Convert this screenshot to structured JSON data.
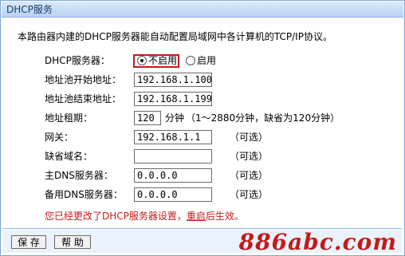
{
  "window": {
    "title": "DHCP服务"
  },
  "intro": "本路由器内建的DHCP服务器能自动配置局域网中各计算机的TCP/IP协议。",
  "fields": {
    "dhcp_server": {
      "label": "DHCP服务器：",
      "options": [
        "不启用",
        "启用"
      ],
      "selected": "不启用"
    },
    "pool_start": {
      "label": "地址池开始地址：",
      "value": "192.168.1.100"
    },
    "pool_end": {
      "label": "地址池结束地址：",
      "value": "192.168.1.199"
    },
    "lease": {
      "label": "地址租期：",
      "value": "120",
      "unit": "分钟",
      "hint": "（1～2880分钟，缺省为120分钟）"
    },
    "gateway": {
      "label": "网关：",
      "value": "192.168.1.1",
      "optional": "（可选）"
    },
    "domain": {
      "label": "缺省域名：",
      "value": "",
      "optional": "（可选）"
    },
    "dns_primary": {
      "label": "主DNS服务器：",
      "value": "0.0.0.0",
      "optional": "（可选）"
    },
    "dns_secondary": {
      "label": "备用DNS服务器：",
      "value": "0.0.0.0",
      "optional": "（可选）"
    }
  },
  "warning": {
    "before": "您已经更改了DHCP服务器设置，",
    "link": "重启",
    "after": "后生效。"
  },
  "buttons": {
    "save": "保 存",
    "help": "帮 助"
  },
  "watermark": "886abc.com",
  "colors": {
    "accent_red": "#c41a1a",
    "titlebar_blue": "#b9d3f1",
    "border_blue": "#7aa6d6"
  }
}
